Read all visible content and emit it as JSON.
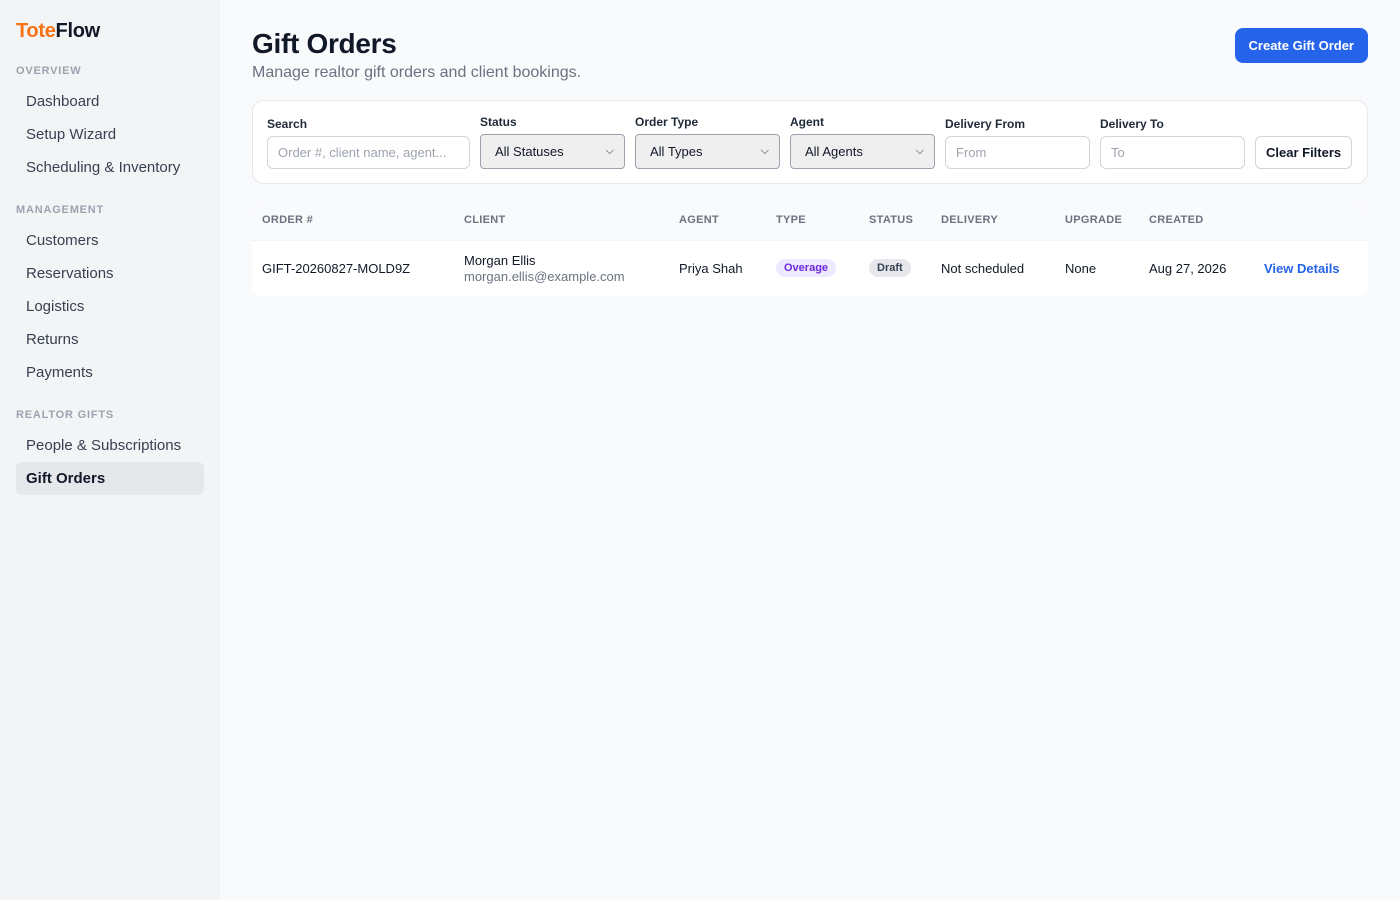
{
  "brand": {
    "part1": "Tote",
    "part2": "Flow"
  },
  "sidebar": {
    "sections": [
      {
        "title": "OVERVIEW",
        "items": [
          "Dashboard",
          "Setup Wizard",
          "Scheduling & Inventory"
        ]
      },
      {
        "title": "MANAGEMENT",
        "items": [
          "Customers",
          "Reservations",
          "Logistics",
          "Returns",
          "Payments"
        ]
      },
      {
        "title": "REALTOR GIFTS",
        "items": [
          "People & Subscriptions",
          "Gift Orders"
        ]
      }
    ],
    "active_item": "Gift Orders"
  },
  "header": {
    "title": "Gift Orders",
    "subtitle": "Manage realtor gift orders and client bookings.",
    "create_button": "Create Gift Order"
  },
  "filters": {
    "search_label": "Search",
    "search_placeholder": "Order #, client name, agent...",
    "status_label": "Status",
    "status_value": "All Statuses",
    "type_label": "Order Type",
    "type_value": "All Types",
    "agent_label": "Agent",
    "agent_value": "All Agents",
    "from_label": "Delivery From",
    "from_placeholder": "From",
    "to_label": "Delivery To",
    "to_placeholder": "To",
    "clear_button": "Clear Filters"
  },
  "table": {
    "columns": [
      "ORDER #",
      "CLIENT",
      "AGENT",
      "TYPE",
      "STATUS",
      "DELIVERY",
      "UPGRADE",
      "CREATED"
    ],
    "rows": [
      {
        "order": "GIFT-20260827-MOLD9Z",
        "client_name": "Morgan Ellis",
        "client_email": "morgan.ellis@example.com",
        "agent": "Priya Shah",
        "type": "Overage",
        "status": "Draft",
        "delivery": "Not scheduled",
        "upgrade": "None",
        "created": "Aug 27, 2026",
        "action": "View Details"
      }
    ]
  },
  "colors": {
    "accent": "#2563eb",
    "brand_orange": "#f97316",
    "overage_badge": "#6d28d9",
    "draft_badge": "#374151"
  }
}
